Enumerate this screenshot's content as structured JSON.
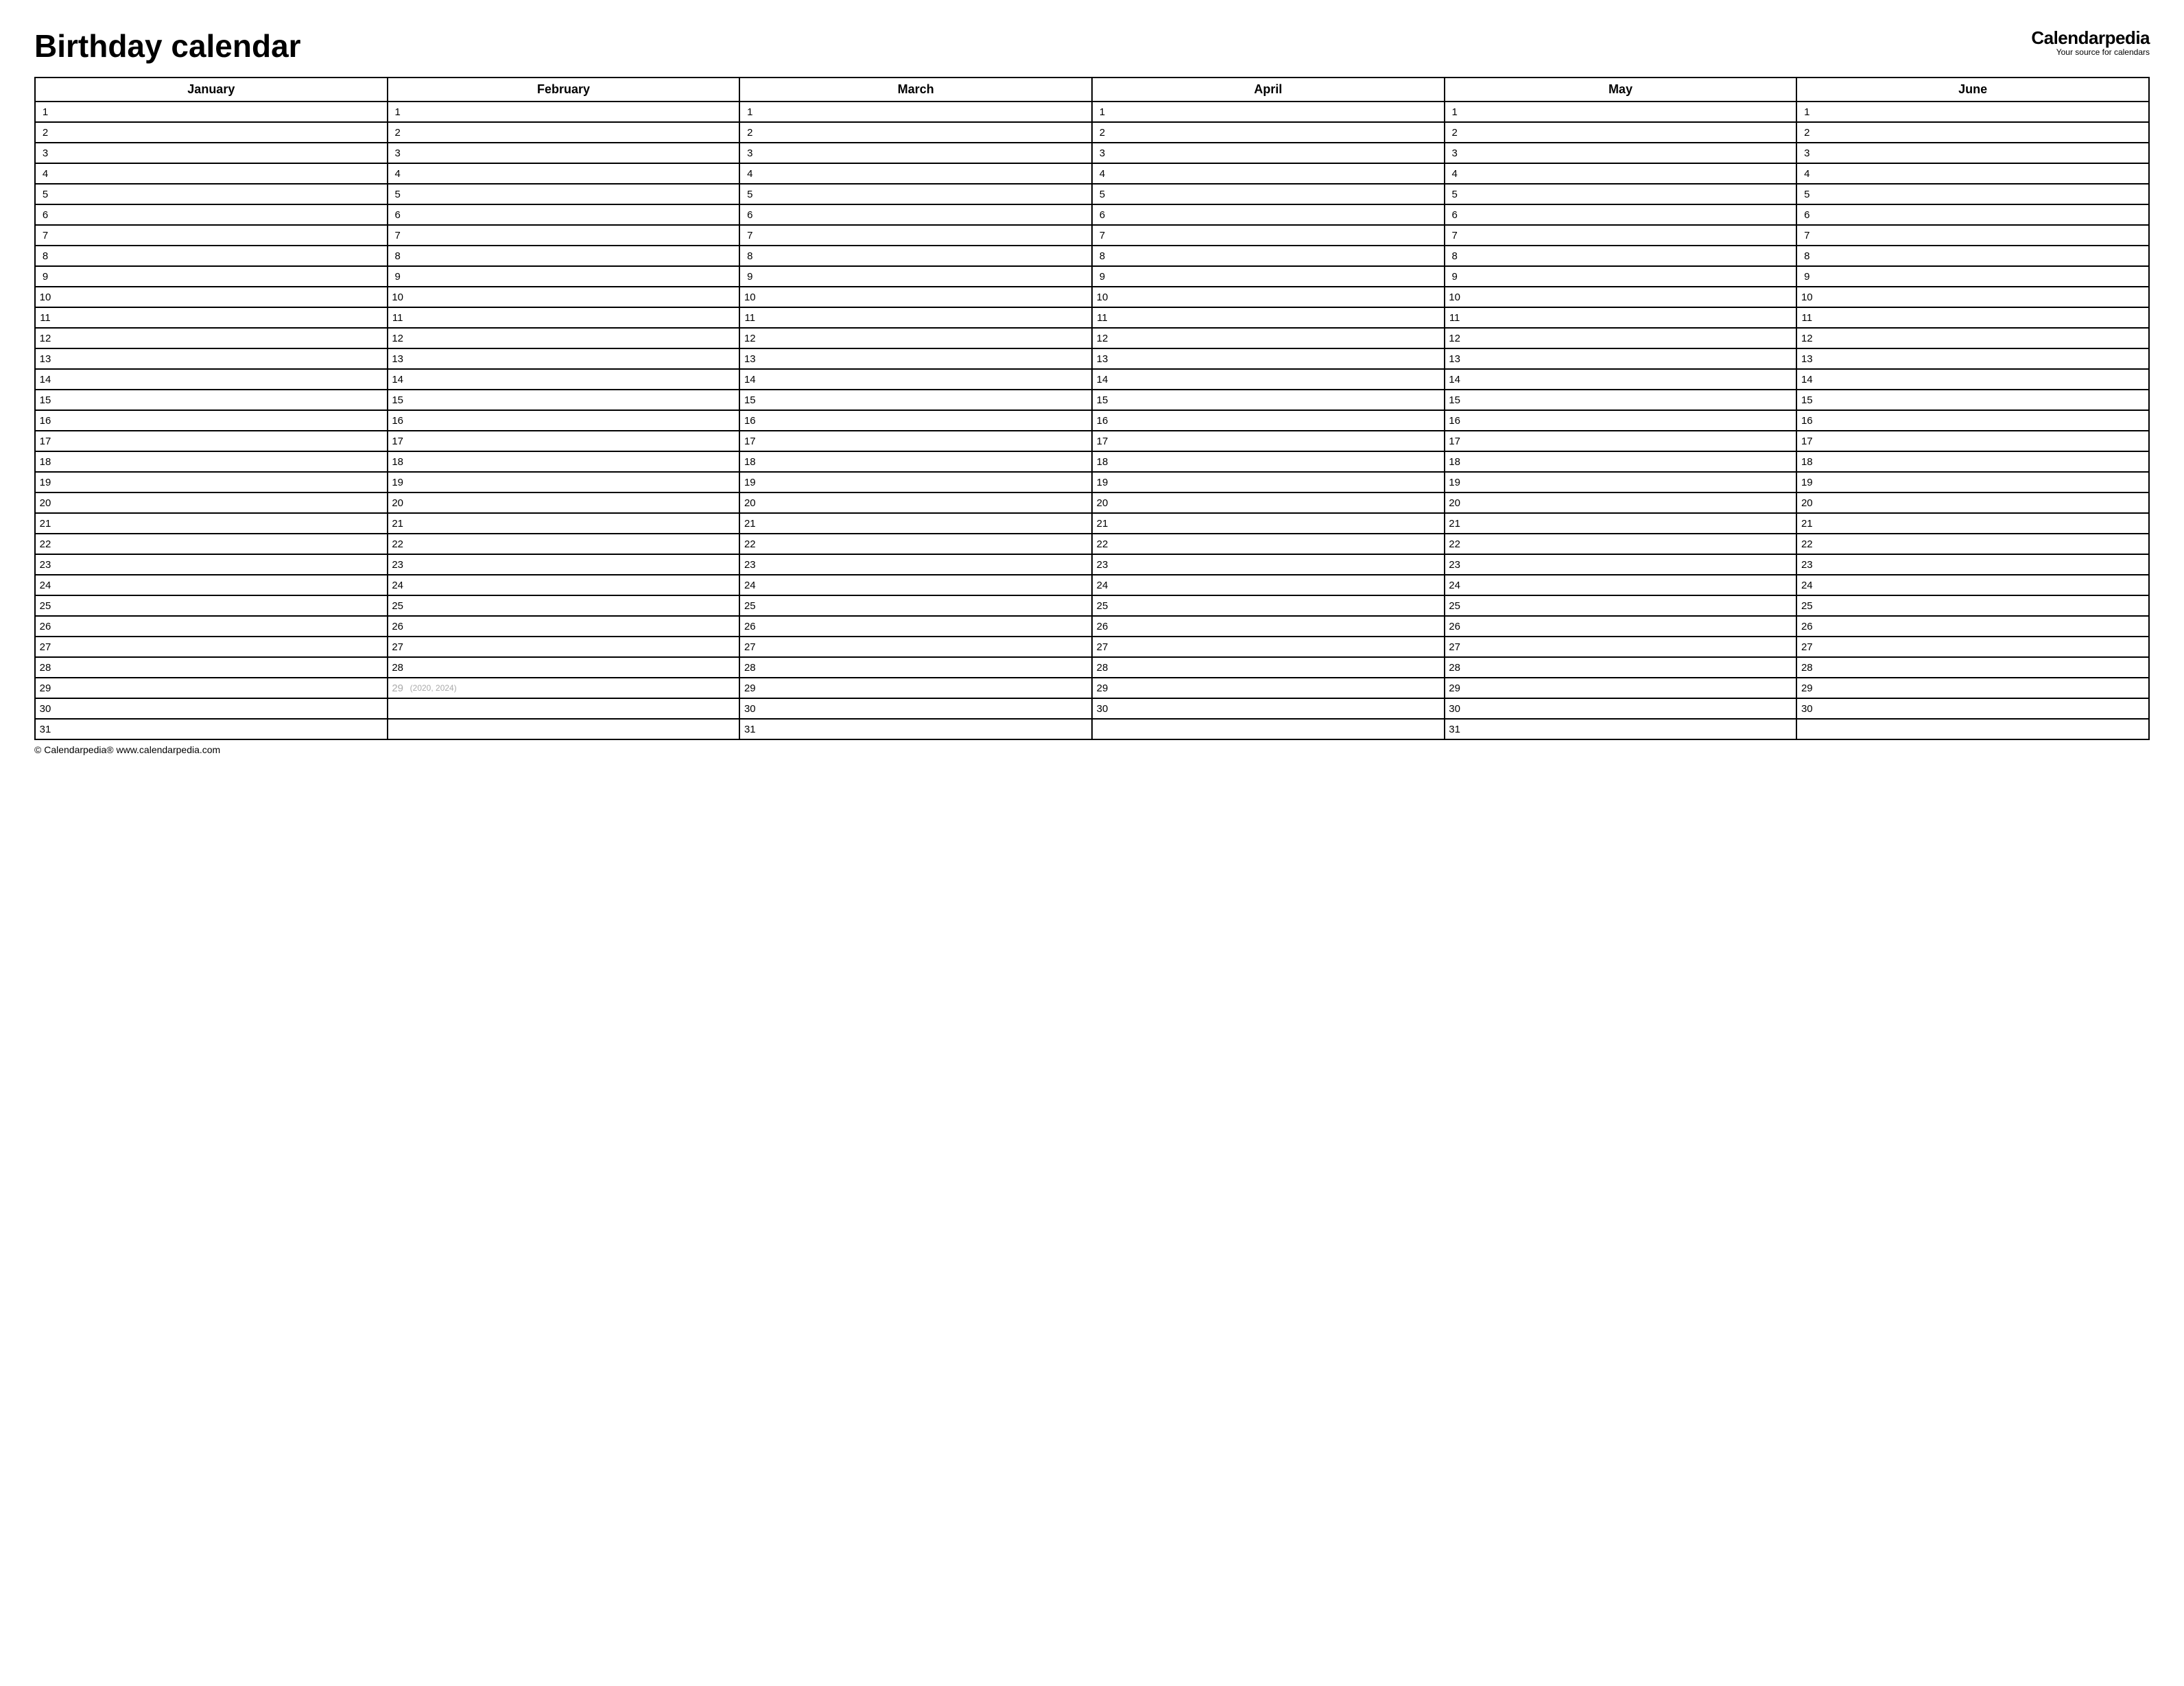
{
  "title": "Birthday calendar",
  "brand": {
    "name": "Calendarpedia",
    "tagline": "Your source for calendars"
  },
  "months": [
    {
      "name": "January",
      "days": 31
    },
    {
      "name": "February",
      "days": 29,
      "leap_day": 29,
      "leap_note": "(2020, 2024)"
    },
    {
      "name": "March",
      "days": 31
    },
    {
      "name": "April",
      "days": 30
    },
    {
      "name": "May",
      "days": 31
    },
    {
      "name": "June",
      "days": 30
    }
  ],
  "max_rows": 31,
  "footer": "© Calendarpedia®   www.calendarpedia.com"
}
